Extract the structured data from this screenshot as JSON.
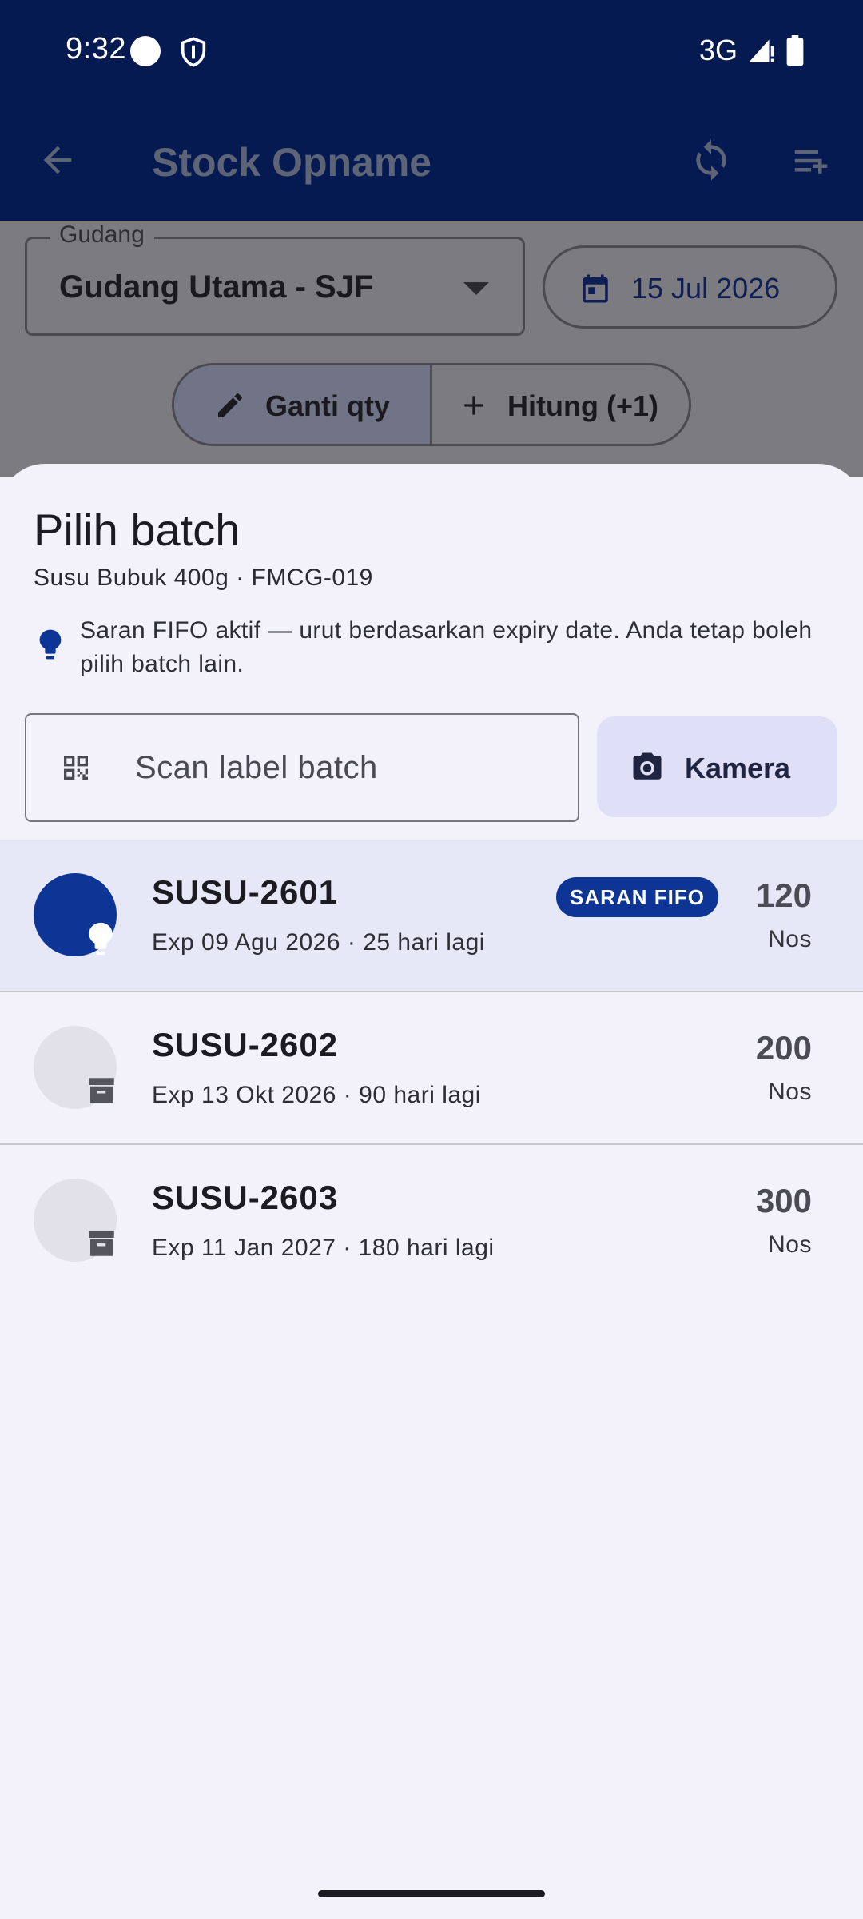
{
  "status_bar": {
    "time": "9:32",
    "network": "3G"
  },
  "app_bar": {
    "title": "Stock Opname"
  },
  "filters": {
    "warehouse_label": "Gudang",
    "warehouse_value": "Gudang Utama - SJF",
    "date": "15 Jul 2026"
  },
  "mode_toggle": {
    "replace_qty_label": "Ganti qty",
    "count_label": "Hitung (+1)"
  },
  "sheet": {
    "title": "Pilih batch",
    "subtitle": "Susu Bubuk 400g · FMCG-019",
    "hint": "Saran FIFO aktif — urut berdasarkan expiry date. Anda tetap boleh pilih batch lain.",
    "scan_placeholder": "Scan label batch",
    "camera_label": "Kamera",
    "batches": [
      {
        "code": "SUSU-2601",
        "expiry": "Exp 09 Agu 2026 · 25 hari lagi",
        "qty": "120",
        "unit": "Nos",
        "badge": "SARAN FIFO",
        "icon": "lightbulb-icon"
      },
      {
        "code": "SUSU-2602",
        "expiry": "Exp 13 Okt 2026 · 90 hari lagi",
        "qty": "200",
        "unit": "Nos",
        "icon": "archive-icon"
      },
      {
        "code": "SUSU-2603",
        "expiry": "Exp 11 Jan 2027 · 180 hari lagi",
        "qty": "300",
        "unit": "Nos",
        "icon": "archive-icon"
      }
    ]
  },
  "colors": {
    "app_bar": "#061a52",
    "accent": "#0c3596",
    "sheet_background": "#f3f1fa",
    "selected_row": "#e6e7f7",
    "camera_button": "#dfe0f7",
    "scrim": "#7b7b80"
  }
}
